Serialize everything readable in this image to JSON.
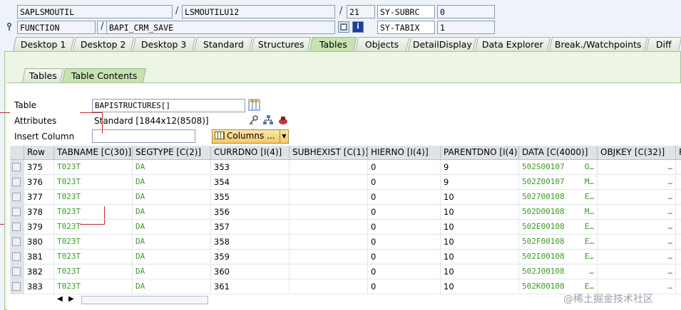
{
  "header": {
    "program": "SAPLSMOUTIL",
    "include": "LSMOUTILU12",
    "line": "21",
    "sy_subrc_label": "SY-SUBRC",
    "sy_subrc_value": "0",
    "type": "FUNCTION",
    "name": "BAPI_CRM_SAVE",
    "sy_tabix_label": "SY-TABIX",
    "sy_tabix_value": "1",
    "separator": "/"
  },
  "tabs": [
    "Desktop 1",
    "Desktop 2",
    "Desktop 3",
    "Standard",
    "Structures",
    "Tables",
    "Objects",
    "DetailDisplay",
    "Data Explorer",
    "Break./Watchpoints",
    "Diff"
  ],
  "active_tab": "Tables",
  "subtabs": [
    "Tables",
    "Table Contents"
  ],
  "active_subtab": "Table Contents",
  "form": {
    "table_label": "Table",
    "table_value": "BAPISTRUCTURES[]",
    "attributes_label": "Attributes",
    "attributes_value": "Standard [1844x12(8508)]",
    "insert_column_label": "Insert Column",
    "insert_column_value": "",
    "columns_button": "Columns ..."
  },
  "grid": {
    "columns": [
      "Row",
      "TABNAME [C(30)]",
      "SEGTYPE [C(2)]",
      "CURRDNO [I(4)]",
      "SUBHEXIST [C(1)]",
      "HIERNO [I(4)]",
      "PARENTDNO [I(4)]",
      "DATA [C(4000)]",
      "OBJKEY [C(32)]",
      "R"
    ],
    "rows": [
      {
        "row": "375",
        "tabname": "T023T",
        "segtype": "DA",
        "currdno": "353",
        "subhexist": "",
        "hierno": "0",
        "parentdno": "9",
        "data": "502S00107",
        "data_tail": "O…",
        "objkey": "…"
      },
      {
        "row": "376",
        "tabname": "T023T",
        "segtype": "DA",
        "currdno": "354",
        "subhexist": "",
        "hierno": "0",
        "parentdno": "9",
        "data": "502Z00107",
        "data_tail": "M…",
        "objkey": "…"
      },
      {
        "row": "377",
        "tabname": "T023T",
        "segtype": "DA",
        "currdno": "355",
        "subhexist": "",
        "hierno": "0",
        "parentdno": "10",
        "data": "502700108",
        "data_tail": "E…",
        "objkey": "…"
      },
      {
        "row": "378",
        "tabname": "T023T",
        "segtype": "DA",
        "currdno": "356",
        "subhexist": "",
        "hierno": "0",
        "parentdno": "10",
        "data": "502D00108",
        "data_tail": "M…",
        "objkey": "…"
      },
      {
        "row": "379",
        "tabname": "T023T",
        "segtype": "DA",
        "currdno": "357",
        "subhexist": "",
        "hierno": "0",
        "parentdno": "10",
        "data": "502E00108",
        "data_tail": "E…",
        "objkey": "…"
      },
      {
        "row": "380",
        "tabname": "T023T",
        "segtype": "DA",
        "currdno": "358",
        "subhexist": "",
        "hierno": "0",
        "parentdno": "10",
        "data": "502F00108",
        "data_tail": "E…",
        "objkey": "…"
      },
      {
        "row": "381",
        "tabname": "T023T",
        "segtype": "DA",
        "currdno": "359",
        "subhexist": "",
        "hierno": "0",
        "parentdno": "10",
        "data": "502I00108",
        "data_tail": "E…",
        "objkey": "…"
      },
      {
        "row": "382",
        "tabname": "T023T",
        "segtype": "DA",
        "currdno": "360",
        "subhexist": "",
        "hierno": "0",
        "parentdno": "10",
        "data": "502J00108",
        "data_tail": "…",
        "objkey": "…"
      },
      {
        "row": "383",
        "tabname": "T023T",
        "segtype": "DA",
        "currdno": "361",
        "subhexist": "",
        "hierno": "0",
        "parentdno": "10",
        "data": "502K00108",
        "data_tail": "E…",
        "objkey": "…"
      }
    ]
  },
  "watermark": "@稀土掘金技术社区",
  "colors": {
    "data_text": "#3e9a26",
    "active_tab": "#c8e1b0",
    "columns_button": "#f1c96c"
  },
  "icons": [
    "gear-icon",
    "info-icon",
    "table-icon",
    "key-icon",
    "network-icon",
    "delete-icon",
    "scroll-left-icon",
    "scroll-right-icon"
  ]
}
